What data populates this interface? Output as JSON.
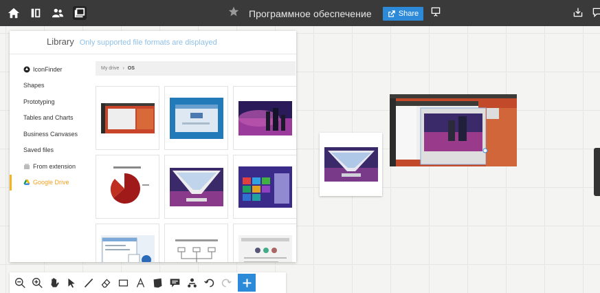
{
  "topbar": {
    "title": "Программное обеспечение",
    "share_label": "Share"
  },
  "library": {
    "title": "Library",
    "subtitle": "Only supported file formats are displayed",
    "nav": [
      {
        "label": "IconFinder",
        "icon": "iconfinder-icon"
      },
      {
        "label": "Shapes"
      },
      {
        "label": "Prototyping"
      },
      {
        "label": "Tables and Charts"
      },
      {
        "label": "Business Canvases"
      },
      {
        "label": "Saved files"
      },
      {
        "label": "From extension",
        "icon": "extension-icon"
      },
      {
        "label": "Google Drive",
        "icon": "google-drive-icon",
        "active": true
      }
    ],
    "breadcrumb": {
      "root": "My drive",
      "separator": "›",
      "current": "OS"
    }
  },
  "colors": {
    "topbar": "#3a3a3a",
    "accent": "#2d8ad9",
    "active_nav": "#f5b31c"
  }
}
